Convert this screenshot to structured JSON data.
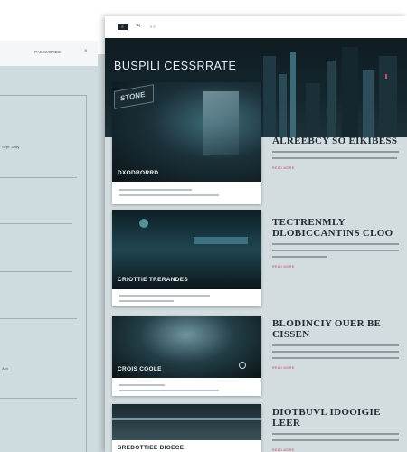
{
  "left_panel": {
    "header_label": "PASSWORDS",
    "close_icon": "×",
    "labels": [
      "Sept. Daily",
      "Ach"
    ]
  },
  "toolbar": {
    "menu_label": "≡",
    "share_icon": "share-icon",
    "share_glyph": "⋖",
    "menu_text": "≡ ≡"
  },
  "hero": {
    "title": "BUSPILI CESSRRATE"
  },
  "articles": [
    {
      "image_caption": "DXODRORRD",
      "sign_text": "STONE",
      "headline": "ALREEBCY SO EIKIBESS",
      "link": "READ MORE"
    },
    {
      "image_caption": "CRIOTTIE TRERANDES",
      "headline": "TECTRENMLY DLOBICCANTINS CLOO",
      "link": "READ MORE"
    },
    {
      "image_caption": "CROIS COOLE",
      "headline": "BLODINCIY OUER BE CISSEN",
      "link": "READ MORE"
    },
    {
      "image_caption": "SREDOTTIEE DIOECE",
      "headline": "DIOTBUVL IDOOIGIE LEER",
      "link": "READ MORE"
    }
  ],
  "colors": {
    "accent": "#c8415a",
    "dark": "#0f1c22",
    "panel": "#cfdcdf"
  }
}
